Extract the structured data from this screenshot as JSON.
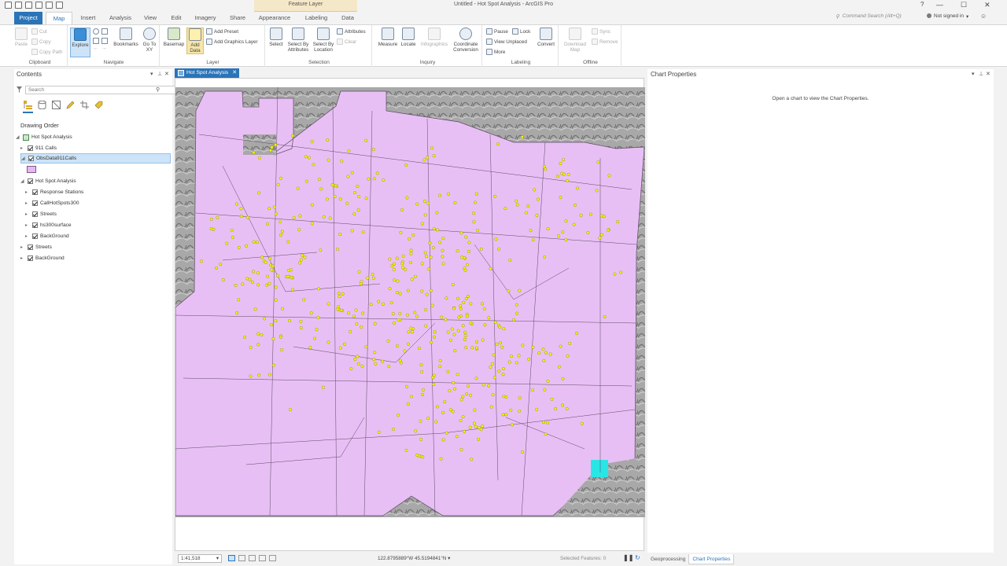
{
  "app": {
    "window_title": "Untitled - Hot Spot Analysis - ArcGIS Pro",
    "contextual_tab": "Feature Layer",
    "help": "?",
    "window_controls": [
      "—",
      "☐",
      "✕"
    ]
  },
  "ribbon_tabs": [
    "Project",
    "Map",
    "Insert",
    "Analysis",
    "View",
    "Edit",
    "Imagery",
    "Share",
    "Appearance",
    "Labeling",
    "Data"
  ],
  "active_tab": "Map",
  "command_search": "Command Search (Alt+Q)",
  "signin": "Not signed in",
  "ribbon": {
    "clipboard": {
      "label": "Clipboard",
      "paste": "Paste",
      "cut": "Cut",
      "copy": "Copy",
      "copy_path": "Copy Path"
    },
    "navigate": {
      "label": "Navigate",
      "explore": "Explore",
      "bookmarks": "Bookmarks",
      "go_to_xy": "Go To XY"
    },
    "layer": {
      "label": "Layer",
      "basemap": "Basemap",
      "add_data": "Add Data",
      "add_preset": "Add Preset",
      "add_graphics_layer": "Add Graphics Layer"
    },
    "selection": {
      "label": "Selection",
      "select": "Select",
      "select_by_attributes": "Select By Attributes",
      "select_by_location": "Select By Location",
      "attributes": "Attributes",
      "clear": "Clear"
    },
    "inquiry": {
      "label": "Inquiry",
      "measure": "Measure",
      "locate": "Locate",
      "infographics": "Infographics",
      "coordinate_conversion": "Coordinate Conversion"
    },
    "labeling": {
      "label": "Labeling",
      "pause": "Pause",
      "lock": "Lock",
      "view_unplaced": "View Unplaced",
      "more": "More",
      "convert": "Convert"
    },
    "offline": {
      "label": "Offline",
      "download_map": "Download Map",
      "sync": "Sync",
      "remove": "Remove"
    }
  },
  "contents": {
    "title": "Contents",
    "search_placeholder": "Search",
    "drawing_order": "Drawing Order",
    "items": [
      {
        "label": "Hot Spot Analysis",
        "type": "map"
      },
      {
        "label": "911 Calls"
      },
      {
        "label": "ObsData911Calls",
        "selected": true
      },
      {
        "label": "Hot Spot Analysis"
      },
      {
        "label": "Response Stations"
      },
      {
        "label": "CallHotSpots300"
      },
      {
        "label": "Streets"
      },
      {
        "label": "hs300surface"
      },
      {
        "label": "BackGround"
      },
      {
        "label": "Streets"
      },
      {
        "label": "BackGround"
      }
    ],
    "legend_color": "#e6b9f2"
  },
  "map_view": {
    "tab_label": "Hot Spot Analysis",
    "polygon_fill": "#e8bff5",
    "point_color": "#f5f000",
    "hillshade": "#9a9a9a",
    "highlight_color": "#28e6e6"
  },
  "status": {
    "scale": "1:41,518",
    "coordinates": "122.8795889°W 45.5194841°N",
    "selected_features": "Selected Features: 0"
  },
  "chart_properties": {
    "title": "Chart Properties",
    "message": "Open a chart to view the Chart Properties."
  },
  "bottom_tabs": [
    "Geoprocessing",
    "Chart Properties"
  ]
}
